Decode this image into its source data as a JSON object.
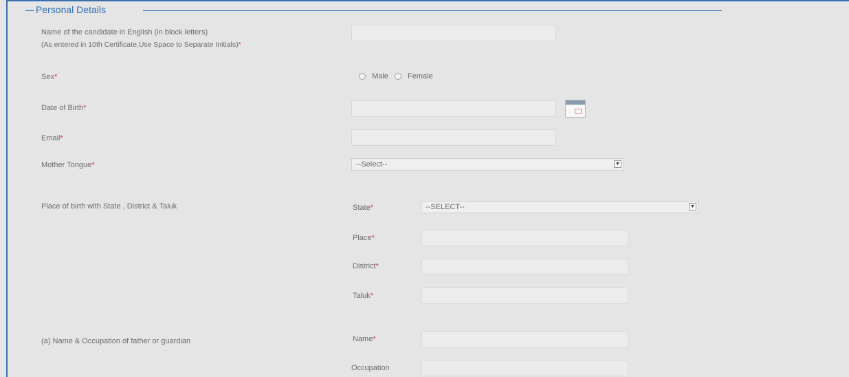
{
  "section": {
    "title": "Personal Details"
  },
  "fields": {
    "name": {
      "label": "Name of the candidate in English (in block letters)",
      "note": "(As entered in 10th Certificate,Use Space to Separate Initials)",
      "required": "*"
    },
    "sex": {
      "label": "Sex",
      "required": "*",
      "options": [
        "Male",
        "Female"
      ]
    },
    "dob": {
      "label": "Date of Birth",
      "required": "*"
    },
    "email": {
      "label": "Email",
      "required": "*"
    },
    "mother_tongue": {
      "label": "Mother Tongue",
      "required": "*",
      "selected": "--Select--"
    },
    "birth_place": {
      "label": "Place of birth with State , District & Taluk",
      "state_label": "State",
      "state_selected": "--SELECT--",
      "place_label": "Place",
      "district_label": "District",
      "taluk_label": "Taluk",
      "required": "*"
    },
    "guardian": {
      "label": "(a) Name & Occupation of father or guardian",
      "name_label": "Name",
      "occupation_label": "Occupation",
      "required": "*"
    }
  },
  "colors": {
    "accent": "#3a79c2",
    "required": "#dd3333",
    "background": "#e5e5e5"
  },
  "icons": {
    "calendar": "calendar-icon",
    "dropdown": "chevron-down-icon"
  }
}
